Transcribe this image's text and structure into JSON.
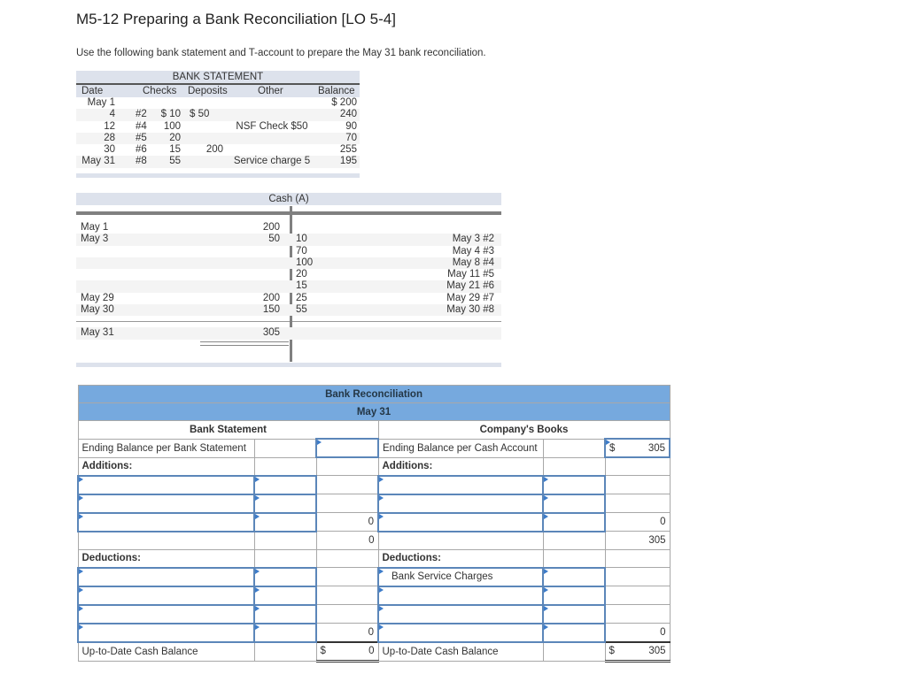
{
  "page": {
    "title": "M5-12 Preparing a Bank Reconciliation [LO 5-4]",
    "intro": "Use the following bank statement and T-account to prepare the May 31 bank reconciliation."
  },
  "bank_statement": {
    "title": "BANK STATEMENT",
    "headers": {
      "date": "Date",
      "checks": "Checks",
      "deposits": "Deposits",
      "other": "Other",
      "balance": "Balance"
    },
    "rows": [
      {
        "date": "May 1",
        "check_no": "",
        "check_amt": "",
        "deposit": "",
        "other": "",
        "balance": "$ 200"
      },
      {
        "date": "4",
        "check_no": "#2",
        "check_amt": "$ 10",
        "deposit": "$ 50",
        "other": "",
        "balance": "240"
      },
      {
        "date": "12",
        "check_no": "#4",
        "check_amt": "100",
        "deposit": "",
        "other": "NSF Check $50",
        "balance": "90"
      },
      {
        "date": "28",
        "check_no": "#5",
        "check_amt": "20",
        "deposit": "",
        "other": "",
        "balance": "70"
      },
      {
        "date": "30",
        "check_no": "#6",
        "check_amt": "15",
        "deposit": "200",
        "other": "",
        "balance": "255"
      },
      {
        "date": "May 31",
        "check_no": "#8",
        "check_amt": "55",
        "deposit": "",
        "other": "Service charge 5",
        "balance": "195"
      }
    ]
  },
  "t_account": {
    "title": "Cash (A)",
    "rows": [
      {
        "left_date": "May 1",
        "left_amt": "200",
        "right_amt": "",
        "right_date": ""
      },
      {
        "left_date": "May 3",
        "left_amt": "50",
        "right_amt": "10",
        "right_date": "May 3 #2"
      },
      {
        "left_date": "",
        "left_amt": "",
        "right_amt": "70",
        "right_date": "May 4 #3"
      },
      {
        "left_date": "",
        "left_amt": "",
        "right_amt": "100",
        "right_date": "May 8 #4"
      },
      {
        "left_date": "",
        "left_amt": "",
        "right_amt": "20",
        "right_date": "May 11 #5"
      },
      {
        "left_date": "",
        "left_amt": "",
        "right_amt": "15",
        "right_date": "May 21 #6"
      },
      {
        "left_date": "May 29",
        "left_amt": "200",
        "right_amt": "25",
        "right_date": "May 29 #7"
      },
      {
        "left_date": "May 30",
        "left_amt": "150",
        "right_amt": "55",
        "right_date": "May 30 #8"
      }
    ],
    "ending": {
      "left_date": "May 31",
      "left_amt": "305"
    }
  },
  "reconciliation": {
    "title": "Bank Reconciliation",
    "date": "May 31",
    "bank_side": {
      "heading": "Bank Statement",
      "ending_label": "Ending Balance per Bank Statement",
      "ending_value": "",
      "additions_label": "Additions:",
      "additions": [
        {
          "label": "",
          "amount": ""
        },
        {
          "label": "",
          "amount": ""
        },
        {
          "label": "",
          "amount": ""
        }
      ],
      "additions_total": "0",
      "subtotal": "0",
      "deductions_label": "Deductions:",
      "deductions": [
        {
          "label": "",
          "amount": ""
        },
        {
          "label": "",
          "amount": ""
        },
        {
          "label": "",
          "amount": ""
        },
        {
          "label": "",
          "amount": ""
        }
      ],
      "deductions_total": "0",
      "final_label": "Up-to-Date Cash Balance",
      "final_currency": "$",
      "final_value": "0"
    },
    "book_side": {
      "heading": "Company's Books",
      "ending_label": "Ending Balance per Cash Account",
      "ending_currency": "$",
      "ending_value": "305",
      "additions_label": "Additions:",
      "additions": [
        {
          "label": "",
          "amount": ""
        },
        {
          "label": "",
          "amount": ""
        },
        {
          "label": "",
          "amount": ""
        }
      ],
      "additions_total": "0",
      "subtotal": "305",
      "deductions_label": "Deductions:",
      "deductions": [
        {
          "label": "Bank Service Charges",
          "amount": ""
        },
        {
          "label": "",
          "amount": ""
        },
        {
          "label": "",
          "amount": ""
        },
        {
          "label": "",
          "amount": ""
        }
      ],
      "deductions_total": "0",
      "final_label": "Up-to-Date Cash Balance",
      "final_currency": "$",
      "final_value": "305"
    }
  }
}
